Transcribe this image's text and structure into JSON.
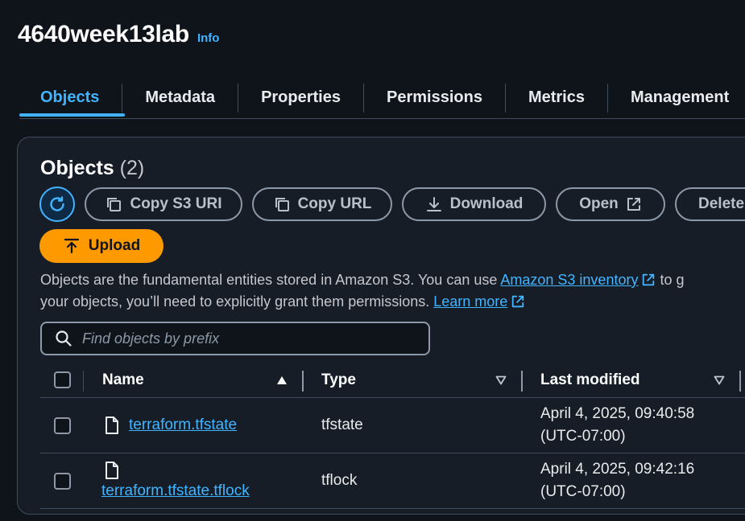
{
  "bucket": {
    "title": "4640week13lab",
    "info_label": "Info"
  },
  "tabs": [
    {
      "label": "Objects"
    },
    {
      "label": "Metadata"
    },
    {
      "label": "Properties"
    },
    {
      "label": "Permissions"
    },
    {
      "label": "Metrics"
    },
    {
      "label": "Management"
    }
  ],
  "objects": {
    "heading": "Objects",
    "count": "(2)",
    "actions": {
      "copy_s3_uri": "Copy S3 URI",
      "copy_url": "Copy URL",
      "download": "Download",
      "open": "Open",
      "delete": "Delete"
    },
    "upload_label": "Upload",
    "description": {
      "line1_prefix": "Objects are the fundamental entities stored in Amazon S3. You can use ",
      "inventory_link": "Amazon S3 inventory",
      "line1_suffix": " to g",
      "line2_prefix": "your objects, you’ll need to explicitly grant them permissions. ",
      "learn_more_link": "Learn more"
    },
    "search": {
      "placeholder": "Find objects by prefix",
      "value": ""
    },
    "table": {
      "headers": {
        "name": "Name",
        "type": "Type",
        "last_modified": "Last modified"
      },
      "rows": [
        {
          "name": "terraform.tfstate",
          "type": "tfstate",
          "date": "April 4, 2025, 09:40:58",
          "tz": "(UTC-07:00)"
        },
        {
          "name": "terraform.tfstate.tflock",
          "type": "tflock",
          "date": "April 4, 2025, 09:42:16",
          "tz": "(UTC-07:00)"
        }
      ]
    }
  },
  "colors": {
    "accent": "#42b4ff",
    "upload": "#ff9900",
    "background": "#0f141a",
    "border": "#414d5c"
  },
  "icons": [
    "refresh-icon",
    "copy-icon",
    "download-icon",
    "external-link-icon",
    "upload-icon",
    "search-icon",
    "sort-asc-icon",
    "sort-desc-icon",
    "file-icon"
  ]
}
